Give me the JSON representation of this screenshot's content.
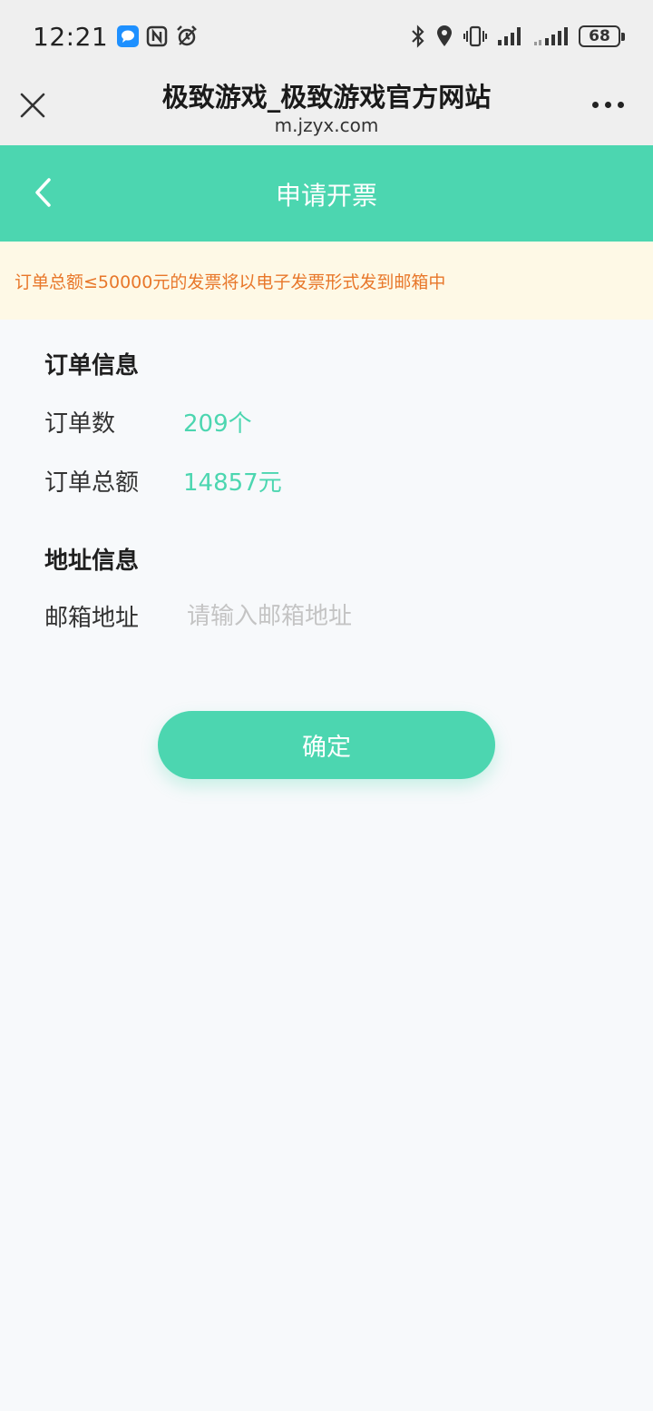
{
  "status_bar": {
    "time": "12:21",
    "battery": "68",
    "left_icons": [
      "message-icon",
      "nfc-icon",
      "alarm-icon"
    ],
    "right_icons": [
      "bluetooth-icon",
      "location-icon",
      "vibrate-icon",
      "signal-icon",
      "signal-icon-2",
      "battery-icon"
    ]
  },
  "browser": {
    "title": "极致游戏_极致游戏官方网站",
    "url": "m.jzyx.com"
  },
  "nav": {
    "title": "申请开票"
  },
  "notice": {
    "text": "订单总额≤50000元的发票将以电子发票形式发到邮箱中"
  },
  "order_info": {
    "title": "订单信息",
    "count_label": "订单数",
    "count_value": "209个",
    "total_label": "订单总额",
    "total_value": "14857元"
  },
  "address_info": {
    "title": "地址信息",
    "email_label": "邮箱地址",
    "email_value": "",
    "email_placeholder": "请输入邮箱地址"
  },
  "confirm_button": {
    "label": "确定"
  },
  "colors": {
    "accent": "#4cd6b0",
    "notice_bg": "#fef9e6",
    "notice_text": "#e8772a",
    "page_bg": "#f7f9fb"
  }
}
